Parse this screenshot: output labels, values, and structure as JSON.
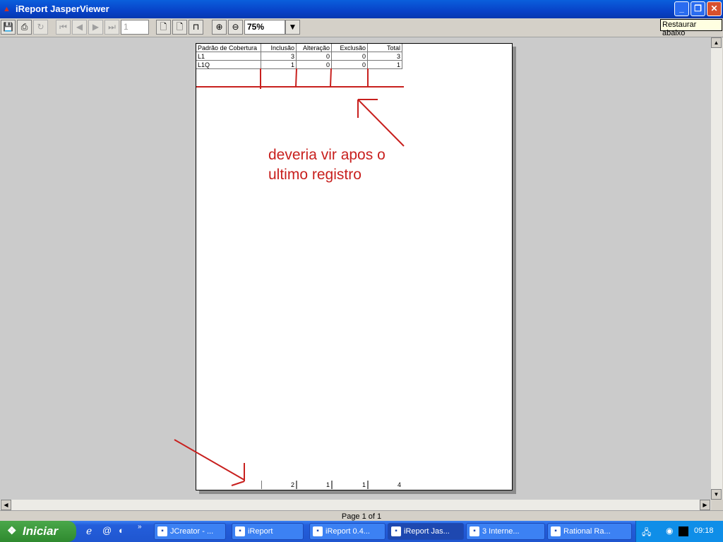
{
  "window": {
    "title": "iReport JasperViewer",
    "tooltip": "Restaurar abaixo"
  },
  "toolbar": {
    "page_input": "1",
    "zoom_value": "75%"
  },
  "report": {
    "headers": [
      "Padrão de Cobertura",
      "Inclusão",
      "Alteração",
      "Exclusão",
      "Total"
    ],
    "rows": [
      [
        "L1",
        "3",
        "0",
        "0",
        "3"
      ],
      [
        "L1Q",
        "1",
        "0",
        "0",
        "1"
      ]
    ],
    "totals": [
      "",
      "2",
      "1",
      "1",
      "4"
    ]
  },
  "annotation": {
    "line1": "deveria vir apos o",
    "line2": "ultimo registro",
    "color": "#c8201e"
  },
  "status": {
    "page_info": "Page 1 of 1"
  },
  "taskbar": {
    "start_label": "Iniciar",
    "tasks": [
      "JCreator - ...",
      "iReport",
      "iReport 0.4...",
      "iReport Jas...",
      "3 Interne...",
      "Rational Ra..."
    ],
    "clock": "09:18"
  }
}
